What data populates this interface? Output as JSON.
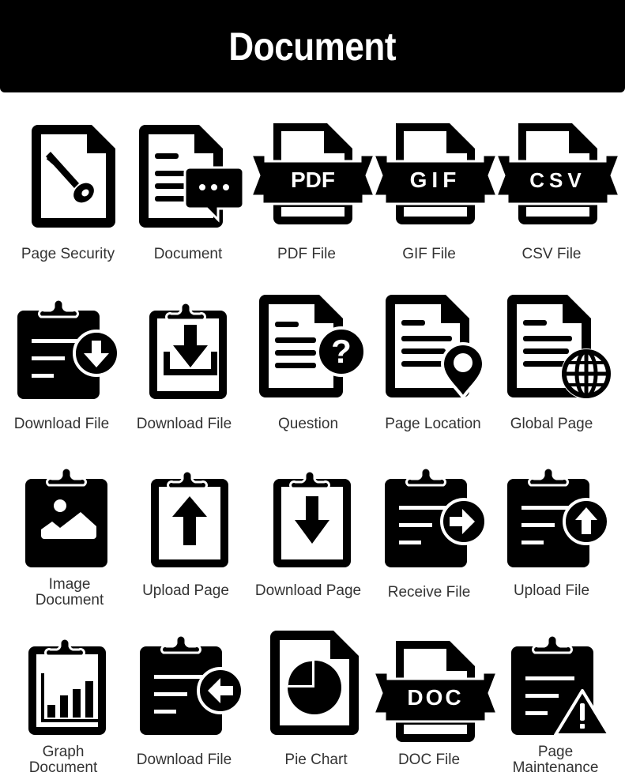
{
  "header": {
    "title": "Document"
  },
  "icons": [
    {
      "label": "Page Security",
      "icon": "page-security-icon"
    },
    {
      "label": "Document",
      "icon": "document-chat-icon"
    },
    {
      "label": "PDF File",
      "icon": "pdf-file-icon",
      "badge": "PDF"
    },
    {
      "label": "GIF File",
      "icon": "gif-file-icon",
      "badge": "GIF"
    },
    {
      "label": "CSV File",
      "icon": "csv-file-icon",
      "badge": "CSV"
    },
    {
      "label": "Download File",
      "icon": "clipboard-download-circle-icon"
    },
    {
      "label": "Download File",
      "icon": "clipboard-download-tray-icon"
    },
    {
      "label": "Question",
      "icon": "document-question-icon"
    },
    {
      "label": "Page Location",
      "icon": "document-location-icon"
    },
    {
      "label": "Global Page",
      "icon": "document-globe-icon"
    },
    {
      "label": "Image Document",
      "line1": "Image",
      "line2": "Document",
      "icon": "clipboard-image-icon"
    },
    {
      "label": "Upload Page",
      "icon": "clipboard-upload-arrow-icon"
    },
    {
      "label": "Download Page",
      "icon": "clipboard-download-arrow-icon"
    },
    {
      "label": "Receive File",
      "icon": "clipboard-receive-icon"
    },
    {
      "label": "Upload File",
      "icon": "clipboard-upload-circle-icon"
    },
    {
      "label": "Graph Document",
      "line1": "Graph",
      "line2": "Document",
      "icon": "clipboard-graph-icon"
    },
    {
      "label": "Download File",
      "icon": "clipboard-left-arrow-icon"
    },
    {
      "label": "Pie Chart",
      "icon": "document-pie-chart-icon"
    },
    {
      "label": "DOC File",
      "icon": "doc-file-icon",
      "badge": "DOC"
    },
    {
      "label": "Page Maintenance",
      "line1": "Page",
      "line2": "Maintenance",
      "icon": "clipboard-warning-icon"
    }
  ]
}
